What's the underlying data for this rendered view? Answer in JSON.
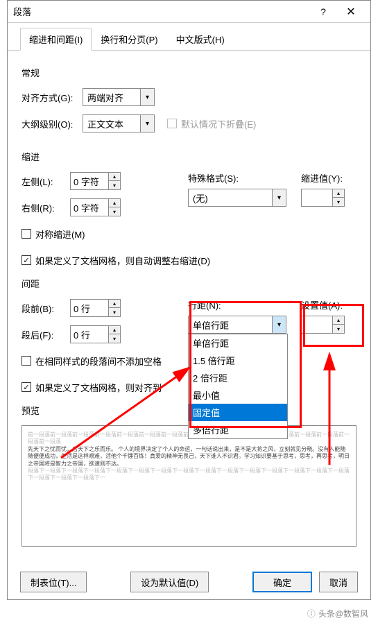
{
  "title": "段落",
  "tabs": {
    "t1": "缩进和间距(I)",
    "t2": "换行和分页(P)",
    "t3": "中文版式(H)"
  },
  "general": {
    "title": "常规",
    "align_label": "对齐方式(G):",
    "align_value": "两端对齐",
    "outline_label": "大纲级别(O):",
    "outline_value": "正文文本",
    "collapse_label": "默认情况下折叠(E)"
  },
  "indent": {
    "title": "缩进",
    "left_label": "左侧(L):",
    "left_value": "0 字符",
    "right_label": "右侧(R):",
    "right_value": "0 字符",
    "special_label": "特殊格式(S):",
    "special_value": "(无)",
    "by_label": "缩进值(Y):",
    "mirror_label": "对称缩进(M)",
    "grid_label": "如果定义了文档网格，则自动调整右缩进(D)"
  },
  "spacing": {
    "title": "间距",
    "before_label": "段前(B):",
    "before_value": "0 行",
    "after_label": "段后(F):",
    "after_value": "0 行",
    "line_label": "行距(N):",
    "line_value": "单倍行距",
    "at_label": "设置值(A):",
    "nospace_label": "在相同样式的段落间不添加空格",
    "grid_label": "如果定义了文档网格，则对齐到",
    "options": [
      "单倍行距",
      "1.5 倍行距",
      "2 倍行距",
      "最小值",
      "固定值",
      "多倍行距"
    ]
  },
  "preview": {
    "title": "预览",
    "gray1": "前一段落前一段落前一段落前一段落前一段落前一段落前一段落前一段落前一段落前一段落前一段落前一段落前一段落前一段落前一段落前一段落",
    "dark": "先天下之忧而忧，后天下之乐而乐。 个人的境界决定了个人的命运，一句话说出来，是不是大将之风，立刻就见分晓。没有人能随随便便成功，生活是这样艰难，活他个千锤百炼！真爱的精神无畏己，天下谁人不识君。学习知识要基于思考，思考，再思考，明日之帝国将是智力之帝国，欲速则不达。",
    "gray2": "段落下一段落下一段落下一段落下一段落下一段落下一段落下一段落下一段落下一段落下一段落下一段落下一段落下一段落下一段落下一段落下一段落下一段落下一"
  },
  "buttons": {
    "tabs": "制表位(T)...",
    "default": "设为默认值(D)",
    "ok": "确定",
    "cancel": "取消"
  },
  "watermark": "头条@数智风"
}
